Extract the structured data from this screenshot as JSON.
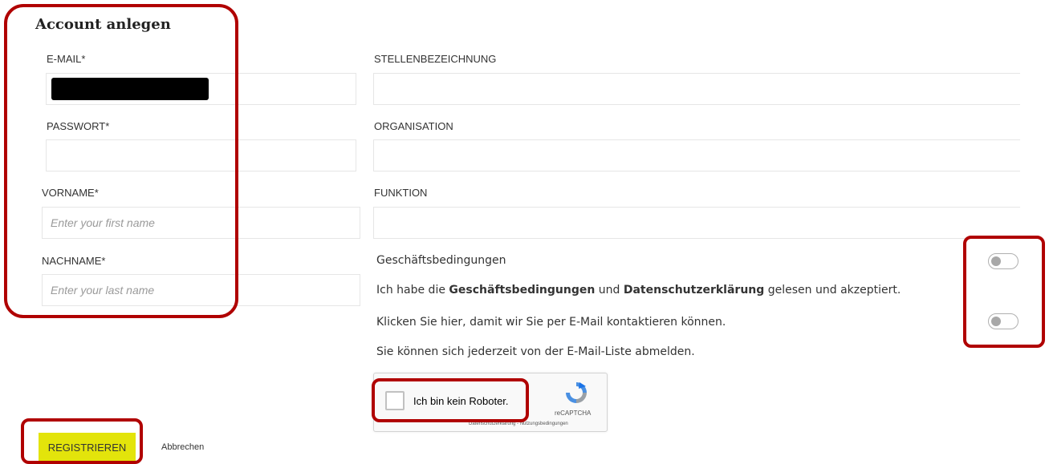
{
  "form": {
    "title": "Account anlegen",
    "left": {
      "email_label": "E-MAIL*",
      "password_label": "PASSWORT*",
      "firstname_label": "VORNAME*",
      "firstname_placeholder": "Enter your first name",
      "lastname_label": "NACHNAME*",
      "lastname_placeholder": "Enter your last name"
    },
    "right": {
      "jobtitle_label": "STELLENBEZEICHNUNG",
      "organisation_label": "ORGANISATION",
      "function_label": "FUNKTION"
    },
    "consent": {
      "terms_title": "Geschäftsbedingungen",
      "terms_prefix": "Ich habe die ",
      "terms_link": "Geschäftsbedingungen",
      "terms_mid": " und ",
      "privacy_link": "Datenschutzerklärung",
      "terms_suffix": " gelesen und akzeptiert.",
      "email_contact": "Klicken Sie hier, damit wir Sie per E-Mail kontaktieren können.",
      "unsubscribe_note": "Sie können sich jederzeit von der E-Mail-Liste abmelden.",
      "terms_toggle_on": false,
      "email_toggle_on": false
    },
    "captcha": {
      "label": "Ich bin kein Roboter.",
      "brand": "reCAPTCHA",
      "links": "Datenschutzerklärung - Nutzungsbedingungen",
      "checked": false,
      "icon": "recaptcha-logo-icon"
    },
    "actions": {
      "register_label": "REGISTRIEREN",
      "cancel_label": "Abbrechen"
    }
  },
  "colors": {
    "primary_button": "#e3e40b",
    "annotation": "#b00000"
  }
}
